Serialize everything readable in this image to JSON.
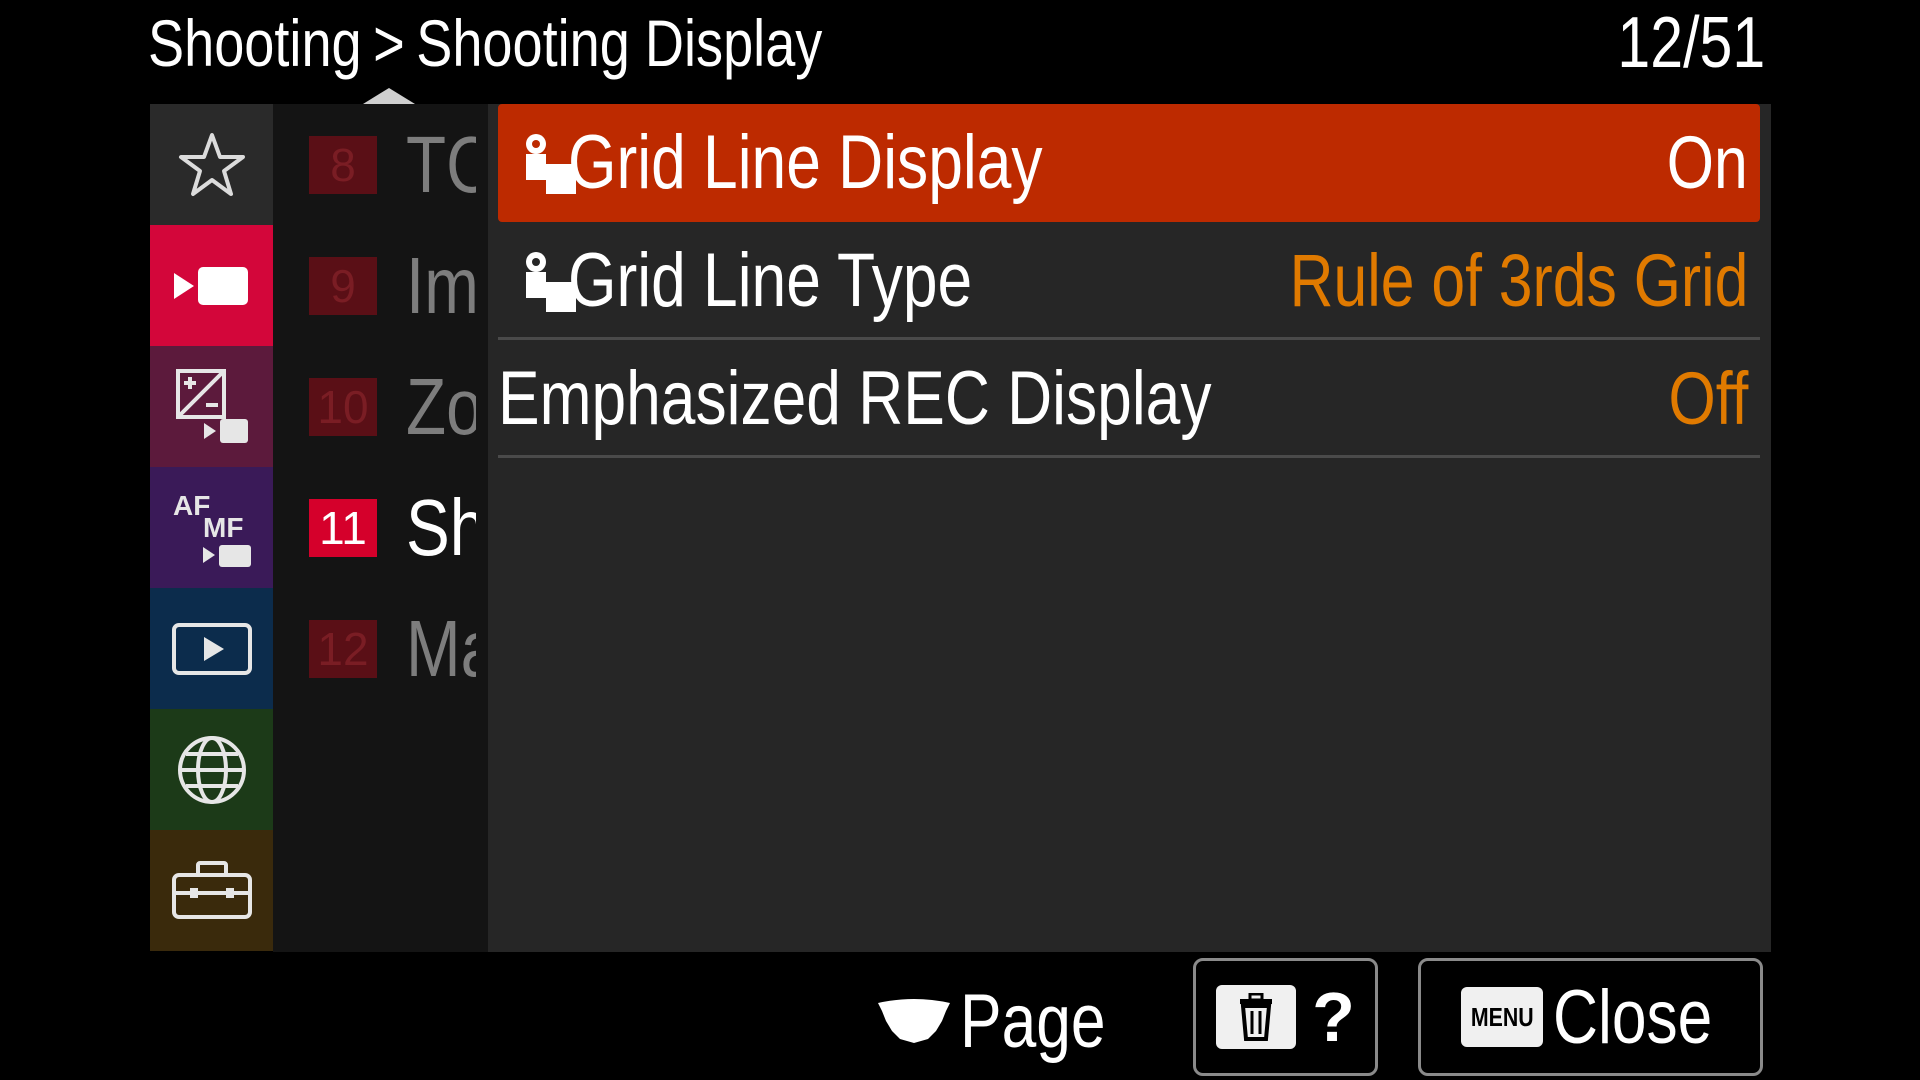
{
  "header": {
    "breadcrumb": [
      "Shooting",
      "Shooting Display"
    ],
    "separator": ">",
    "page_counter": "12/51"
  },
  "sidebar": {
    "tabs": [
      {
        "id": "my-menu",
        "icon": "star-icon",
        "color": "#2a2a2a",
        "active": false
      },
      {
        "id": "shooting",
        "icon": "movie-camera-icon",
        "color": "#d3063a",
        "active": true
      },
      {
        "id": "exposure-color",
        "icon": "exposure-compensation-icon",
        "color": "#5c1a3c",
        "active": false
      },
      {
        "id": "focus",
        "icon": "af-mf-icon",
        "color": "#3a1a58",
        "active": false
      },
      {
        "id": "playback",
        "icon": "playback-icon",
        "color": "#0c2c4c",
        "active": false
      },
      {
        "id": "network",
        "icon": "globe-icon",
        "color": "#1c3a18",
        "active": false
      },
      {
        "id": "setup",
        "icon": "toolbox-icon",
        "color": "#3a2a0c",
        "active": false
      }
    ],
    "af_label": "AF",
    "mf_label": "MF"
  },
  "pages": [
    {
      "num": "8",
      "label": "TC",
      "active": false
    },
    {
      "num": "9",
      "label": "Im",
      "active": false
    },
    {
      "num": "10",
      "label": "Zo",
      "active": false
    },
    {
      "num": "11",
      "label": "Sh",
      "active": true
    },
    {
      "num": "12",
      "label": "Ma",
      "active": false
    }
  ],
  "menu": {
    "items": [
      {
        "label": "Grid Line Display",
        "value": "On",
        "icon": "camera-settings-icon",
        "selected": true
      },
      {
        "label": "Grid Line Type",
        "value": "Rule of 3rds Grid",
        "icon": "camera-settings-icon",
        "selected": false
      },
      {
        "label": "Emphasized REC Display",
        "value": "Off",
        "icon": "",
        "selected": false
      }
    ]
  },
  "footer": {
    "page_label": "Page",
    "help_label": "?",
    "menu_key": "MENU",
    "close_label": "Close"
  },
  "colors": {
    "selected_row": "#bd2a00",
    "value_text": "#e07a00",
    "active_page": "#d5002b"
  }
}
